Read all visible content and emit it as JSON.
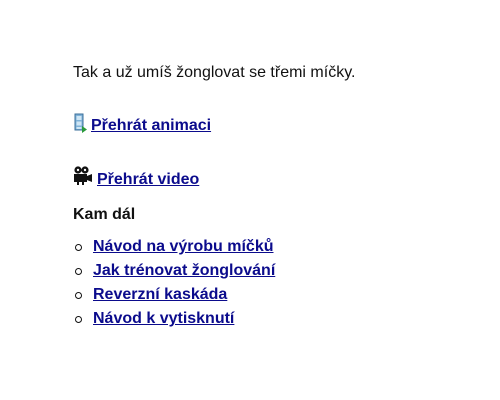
{
  "intro_text": "Tak a už umíš žonglovat se třemi míčky.",
  "media": {
    "animation": {
      "icon": "film-strip-icon",
      "label": "Přehrát animaci"
    },
    "video": {
      "icon": "movie-camera-icon",
      "label": "Přehrát video"
    }
  },
  "next_steps": {
    "heading": "Kam dál",
    "links": [
      "Návod na výrobu míčků",
      "Jak trénovat žonglování",
      "Reverzní kaskáda",
      "Návod k vytisknutí"
    ]
  },
  "colors": {
    "link": "#0b0b8c",
    "text": "#111111",
    "background": "#ffffff"
  }
}
